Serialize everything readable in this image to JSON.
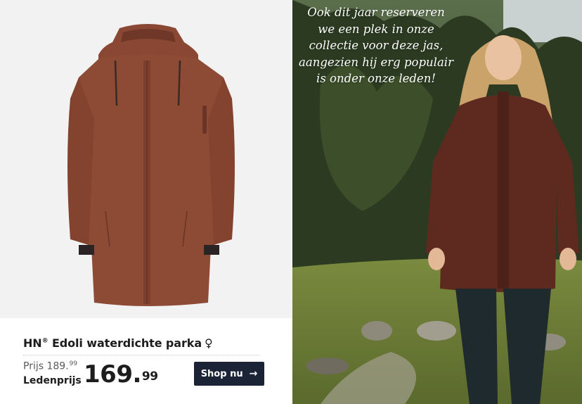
{
  "product": {
    "brand": "HN",
    "brand_mark": "®",
    "name": " Edoli waterdichte parka",
    "gender_symbol": "♀",
    "price_label": "Prijs",
    "price_int": "189.",
    "price_dec": "99",
    "member_label": "Ledenprijs",
    "member_price_int": "169.",
    "member_price_dec": "99"
  },
  "cta": {
    "label": "Shop nu",
    "arrow": "→",
    "arrow_icon": "arrow-right-icon"
  },
  "quote": {
    "text": "Ook dit jaar reserveren we een plek in onze collectie voor deze jas, aangezien hij erg populair is onder onze leden!"
  },
  "colors": {
    "jacket": "#8d4a34",
    "button_bg": "#1b2436",
    "quote_text": "#ffffff"
  }
}
